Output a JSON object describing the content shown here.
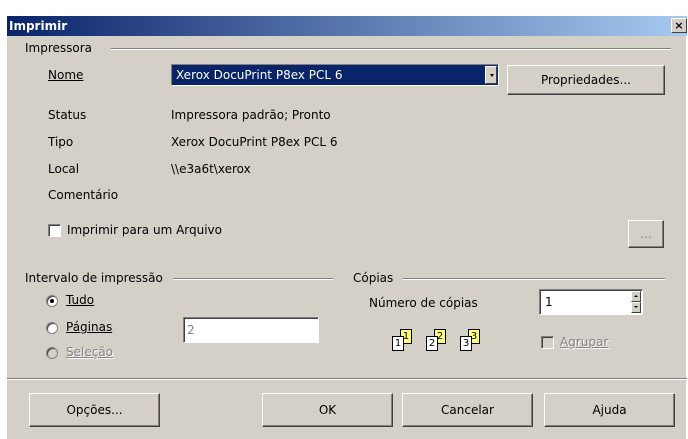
{
  "window": {
    "title": "Imprimir",
    "close_glyph": "×"
  },
  "printer": {
    "group_title": "Impressora",
    "name_label": "Nome",
    "name_value": "Xerox DocuPrint P8ex PCL 6",
    "properties_button": "Propriedades...",
    "status_label": "Status",
    "status_value": "Impressora padrão; Pronto",
    "type_label": "Tipo",
    "type_value": "Xerox DocuPrint P8ex PCL 6",
    "location_label": "Local",
    "location_value": "\\\\e3a6t\\xerox",
    "comment_label": "Comentário",
    "comment_value": "",
    "print_to_file_label": "Imprimir para um Arquivo",
    "print_to_file_checked": false,
    "browse_button": "..."
  },
  "range": {
    "group_title": "Intervalo de impressão",
    "all_label": "Tudo",
    "pages_label": "Páginas",
    "pages_value": "2",
    "selection_label": "Seleção",
    "selected": "all"
  },
  "copies": {
    "group_title": "Cópias",
    "count_label": "Número de cópias",
    "count_value": "1",
    "collate_label": "Agrupar",
    "collate_checked": false,
    "icon_pages": [
      "1",
      "1",
      "2",
      "2",
      "3",
      "3"
    ]
  },
  "buttons": {
    "options": "Opções...",
    "ok": "OK",
    "cancel": "Cancelar",
    "help": "Ajuda"
  }
}
